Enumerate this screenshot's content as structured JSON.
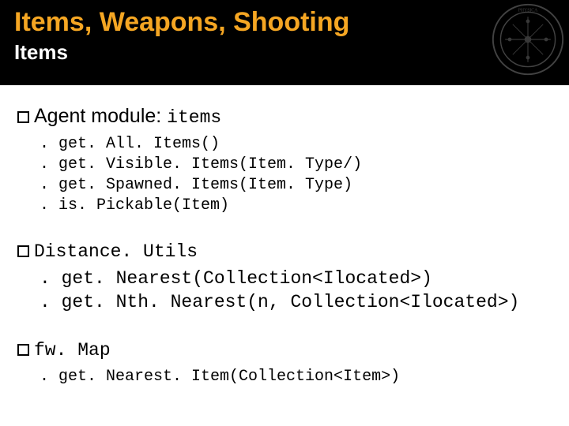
{
  "header": {
    "title": "Items, Weapons, Shooting",
    "subtitle": "Items"
  },
  "sections": [
    {
      "heading_prefix": "Agent module: ",
      "heading_mono": "items",
      "items": [
        ". get. All. Items()",
        ". get. Visible. Items(Item. Type/)",
        ". get. Spawned. Items(Item. Type)",
        ". is. Pickable(Item)"
      ]
    },
    {
      "heading_prefix": "",
      "heading_mono": "Distance. Utils",
      "items": [
        ". get. Nearest(Collection<Ilocated>)",
        ". get. Nth. Nearest(n, Collection<Ilocated>)"
      ]
    },
    {
      "heading_prefix": "",
      "heading_mono": "fw. Map",
      "items": [
        ". get. Nearest. Item(Collection<Item>)"
      ]
    }
  ]
}
